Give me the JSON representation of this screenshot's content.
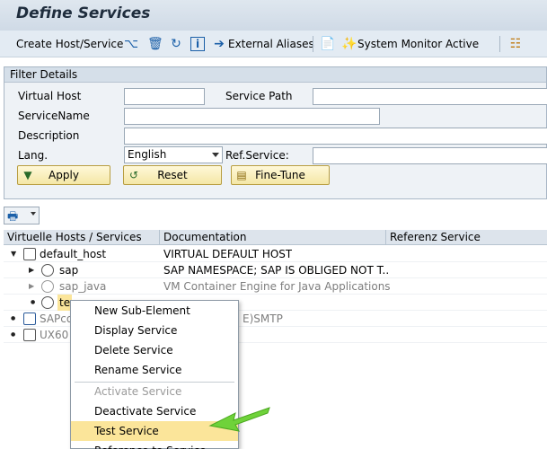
{
  "window": {
    "title": "Define Services"
  },
  "toolbar": {
    "create_host_service": "Create Host/Service",
    "external_aliases": "External Aliases",
    "system_monitor_active": "System Monitor Active",
    "icons": [
      "glasses-icon",
      "trash-icon",
      "refresh-icon",
      "info-icon",
      "arrow-right-icon",
      "document-icon",
      "wand-icon",
      "hierarchy-icon"
    ]
  },
  "filter": {
    "title": "Filter Details",
    "virtual_host_label": "Virtual Host",
    "virtual_host_value": "",
    "service_path_label": "Service Path",
    "service_path_value": "",
    "service_name_label": "ServiceName",
    "service_name_value": "",
    "description_label": "Description",
    "description_value": "",
    "lang_label": "Lang.",
    "lang_value": "English",
    "ref_service_label": "Ref.Service:",
    "ref_service_value": "",
    "apply": "Apply",
    "reset": "Reset",
    "fine_tune": "Fine-Tune"
  },
  "grid": {
    "col_hosts": "Virtuelle Hosts / Services",
    "col_doc": "Documentation",
    "col_ref": "Referenz Service",
    "rows": [
      {
        "name": "default_host",
        "doc": "VIRTUAL DEFAULT HOST"
      },
      {
        "name": "sap",
        "doc": "SAP NAMESPACE; SAP IS OBLIGED NOT T..."
      },
      {
        "name": "sap_java",
        "doc": "VM Container Engine for Java Applications"
      },
      {
        "name": "te",
        "doc": ""
      },
      {
        "name": "SAPco",
        "doc": "E)SMTP"
      },
      {
        "name": "UX60",
        "doc": ""
      }
    ]
  },
  "context_menu": {
    "items": [
      {
        "label": "New Sub-Element"
      },
      {
        "label": "Display Service"
      },
      {
        "label": "Delete Service"
      },
      {
        "label": "Rename Service"
      },
      {
        "label": "Activate Service"
      },
      {
        "label": "Deactivate Service"
      },
      {
        "label": "Test Service"
      },
      {
        "label": "Reference to Service"
      }
    ]
  },
  "colors": {
    "highlight": "#fbe59a",
    "annotation_arrow": "#6fd23a",
    "header_bg": "#dfe7ef"
  }
}
